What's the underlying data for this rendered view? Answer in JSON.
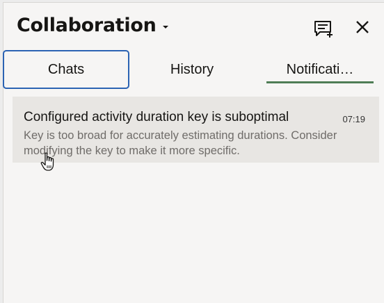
{
  "header": {
    "title": "Collaboration",
    "icons": {
      "new_chat": "new-chat-icon",
      "close": "close-icon",
      "dropdown": "chevron-down-icon"
    }
  },
  "tabs": [
    {
      "label": "Chats"
    },
    {
      "label": "History"
    },
    {
      "label": "Notificati…"
    }
  ],
  "active_tab_index": 2,
  "focused_tab_index": 0,
  "notifications": [
    {
      "title": "Configured activity duration key is suboptimal",
      "time": "07:19",
      "body": "Key is too broad for accurately estimating durations. Consider modifying the key to make it more specific."
    }
  ],
  "colors": {
    "focus_ring": "#2b63b3",
    "active_tab_indicator": "#4f7d55",
    "panel_bg": "#f6f5f4",
    "item_bg": "#e8e6e3"
  }
}
